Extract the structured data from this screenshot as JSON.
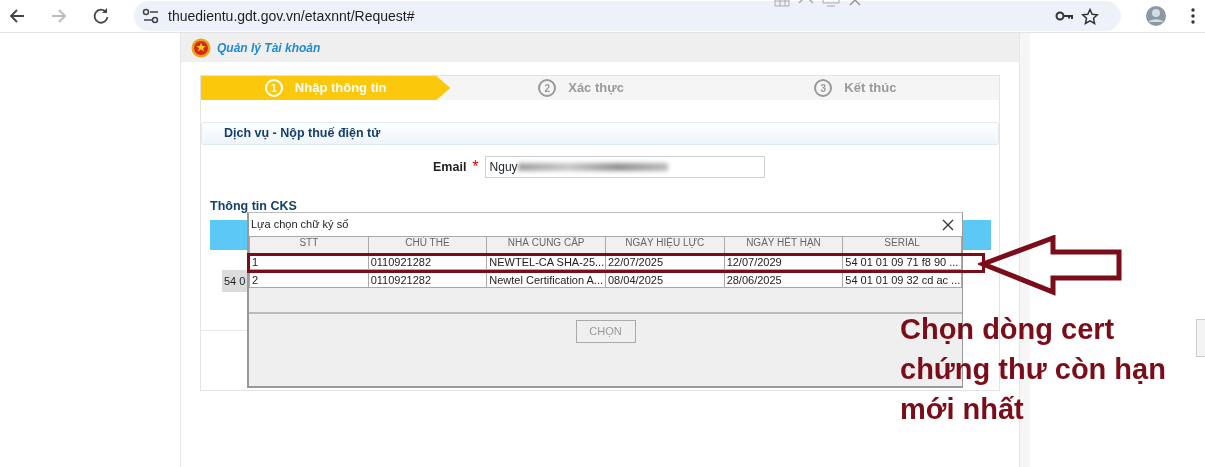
{
  "browser": {
    "url": "thuedientu.gdt.gov.vn/etaxnnt/Request#",
    "forward_disabled": true
  },
  "header": {
    "title": "Quản lý Tài khoản"
  },
  "steps": [
    {
      "number": "1",
      "label": "Nhập thông tin",
      "selected": true
    },
    {
      "number": "2",
      "label": "Xác thực",
      "selected": false
    },
    {
      "number": "3",
      "label": "Kết thúc",
      "selected": false
    }
  ],
  "section_title": "Dịch vụ - Nộp thuế điện tử",
  "email": {
    "label": "Email",
    "required_mark": "*",
    "value": "Nguy"
  },
  "cks": {
    "title": "Thông tin CKS",
    "cell": "54 0"
  },
  "dialog": {
    "title": "Lựa chọn chữ ký số",
    "columns": [
      "STT",
      "CHỦ THỂ",
      "NHÀ CUNG CẤP",
      "NGÀY HIỆU LỰC",
      "NGÀY HẾT HẠN",
      "SERIAL"
    ],
    "rows": [
      {
        "highlighted": true,
        "cells": [
          "1",
          "0110921282",
          "NEWTEL-CA SHA-25...",
          "22/07/2025",
          "12/07/2029",
          "54 01 01 09 71 f8 90 ..."
        ]
      },
      {
        "highlighted": false,
        "cells": [
          "2",
          "0110921282",
          "Newtel Certification A...",
          "08/04/2025",
          "28/06/2025",
          "54 01 01 09 32 cd ac ..."
        ]
      }
    ],
    "button": {
      "label": "CHỌN",
      "disabled": true
    }
  },
  "annotation": {
    "text": "Chọn dòng cert chứng thư còn hạn mới nhất"
  }
}
